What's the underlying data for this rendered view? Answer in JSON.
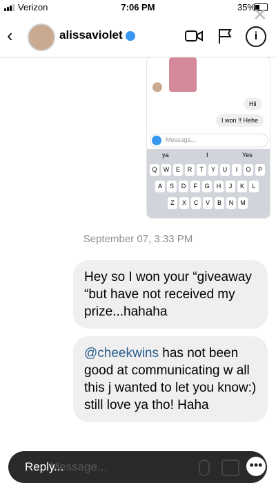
{
  "status": {
    "carrier": "Verizon",
    "time": "7:06 PM",
    "battery": "35%"
  },
  "header": {
    "username": "alissaviolet"
  },
  "screenshot": {
    "bubble1": "Hii",
    "bubble2": "I won !! Hehe",
    "input_placeholder": "Message...",
    "suggestions": [
      "ya",
      "I",
      "Yes"
    ],
    "keys": [
      [
        "Q",
        "W",
        "E",
        "R",
        "T",
        "Y",
        "U",
        "I",
        "O",
        "P"
      ],
      [
        "A",
        "S",
        "D",
        "F",
        "G",
        "H",
        "J",
        "K",
        "L"
      ],
      [
        "Z",
        "X",
        "C",
        "V",
        "B",
        "N",
        "M"
      ]
    ]
  },
  "thread": {
    "date": "September 07, 3:33 PM",
    "message1": "Hey so I won your “giveaway “but have not received my prize...hahaha",
    "message2_mention": "@cheekwins",
    "message2_rest": " has not been good at communicating w all this j wanted to let you know:) still love ya tho! Haha"
  },
  "reply": {
    "placeholder": "Message...",
    "label": "Reply..."
  }
}
